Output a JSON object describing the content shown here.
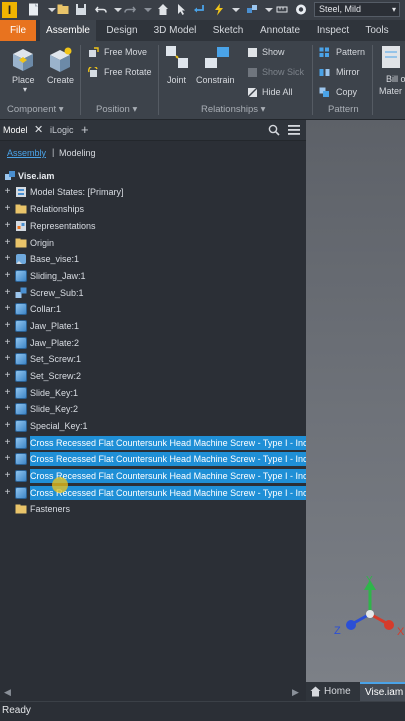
{
  "quick_access": {
    "material": "Steel, Mild"
  },
  "tabs": [
    "File",
    "Assemble",
    "Design",
    "3D Model",
    "Sketch",
    "Annotate",
    "Inspect",
    "Tools"
  ],
  "ribbon": {
    "place": "Place",
    "create": "Create",
    "free_move": "Free Move",
    "free_rotate": "Free Rotate",
    "joint": "Joint",
    "constrain": "Constrain",
    "show": "Show",
    "show_sick": "Show Sick",
    "hide_all": "Hide All",
    "pattern": "Pattern",
    "mirror": "Mirror",
    "copy": "Copy",
    "bill_1": "Bill o",
    "bill_2": "Mater",
    "panels": {
      "component": "Component",
      "position": "Position",
      "relationships": "Relationships",
      "pattern": "Pattern"
    }
  },
  "browser": {
    "tab_model": "Model",
    "tab_ilogic": "iLogic",
    "mode_assembly": "Assembly",
    "mode_modeling": "Modeling",
    "root": "Vise.iam",
    "items": [
      "Model States: [Primary]",
      "Relationships",
      "Representations",
      "Origin",
      "Base_vise:1",
      "Sliding_Jaw:1",
      "Screw_Sub:1",
      "Collar:1",
      "Jaw_Plate:1",
      "Jaw_Plate:2",
      "Set_Screw:1",
      "Set_Screw:2",
      "Slide_Key:1",
      "Slide_Key:2",
      "Special_Key:1",
      "Cross Recessed Flat Countersunk Head Machine Screw - Type I - Inc",
      "Cross Recessed Flat Countersunk Head Machine Screw - Type I - Inc",
      "Cross Recessed Flat Countersunk Head Machine Screw - Type I - Inc",
      "Cross Recessed Flat Countersunk Head Machine Screw - Type I - Inc",
      "Fasteners"
    ]
  },
  "doc_tabs": {
    "home": "Home",
    "vise": "Vise.iam"
  },
  "axes": {
    "y": "Y",
    "z": "Z",
    "x": "X"
  },
  "status": "Ready",
  "colors": {
    "file_tab": "#e8731f",
    "selection": "#1f8fd6",
    "accent_link": "#4aa3e8"
  }
}
